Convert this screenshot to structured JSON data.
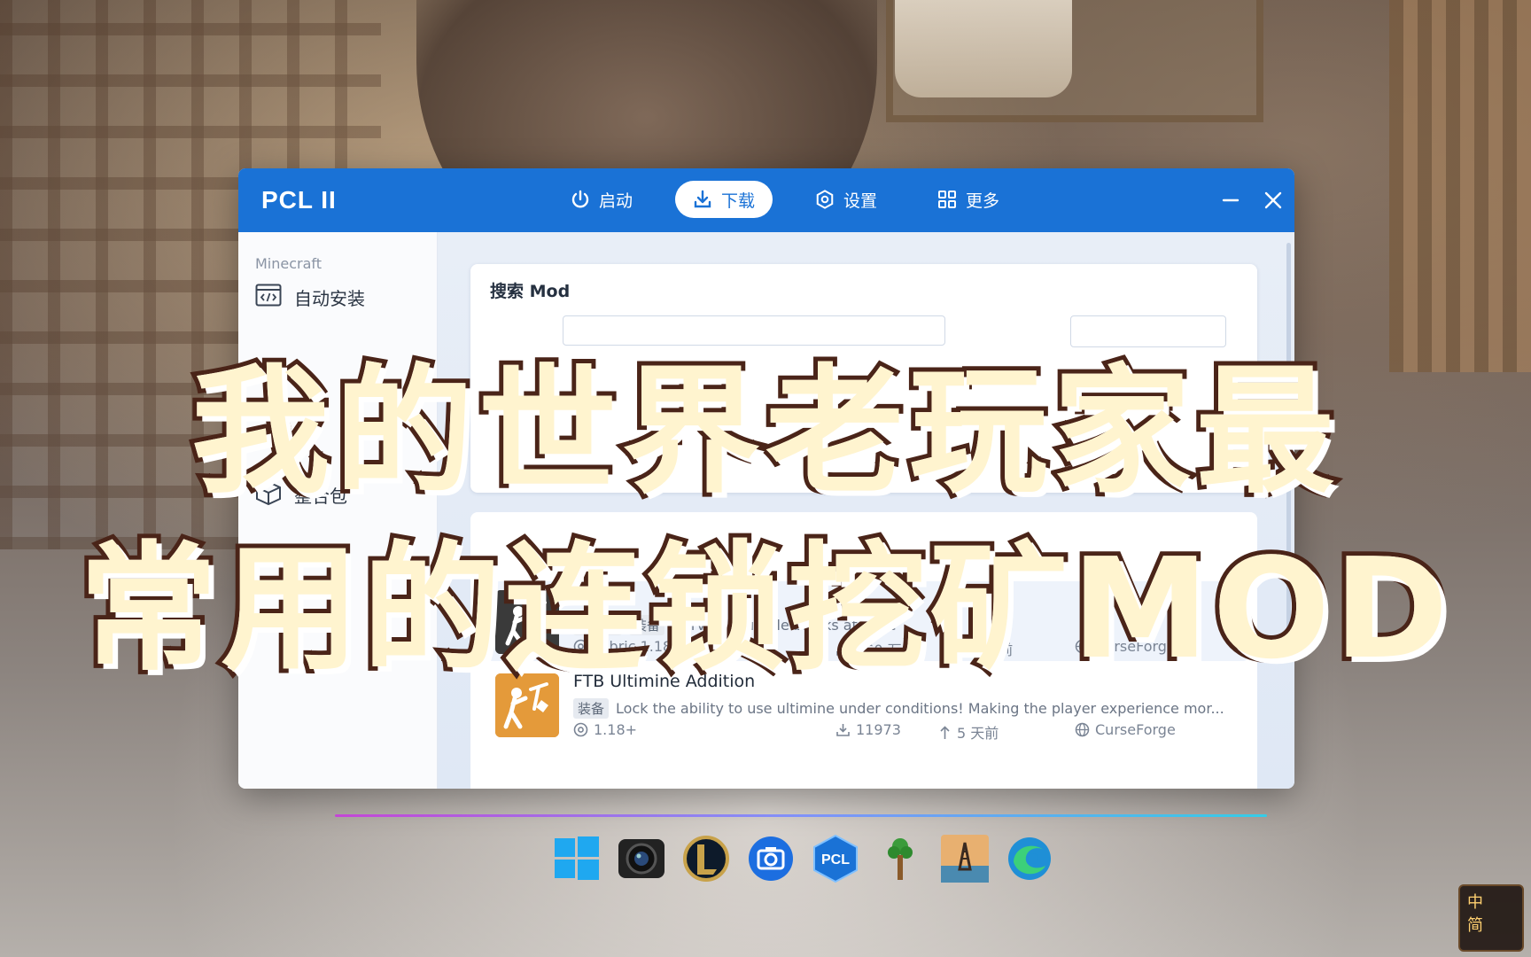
{
  "window": {
    "title": "PCL II",
    "nav_tabs": [
      {
        "label": "启动",
        "icon": "power-icon",
        "active": false
      },
      {
        "label": "下载",
        "icon": "download-icon",
        "active": true
      },
      {
        "label": "设置",
        "icon": "settings-icon",
        "active": false
      },
      {
        "label": "更多",
        "icon": "grid-icon",
        "active": false
      }
    ],
    "controls": {
      "minimize": "minimize-icon",
      "close": "close-icon"
    }
  },
  "sidebar": {
    "section": "Minecraft",
    "items": [
      {
        "label": "自动安装",
        "icon": "code-window-icon"
      },
      {
        "label": "整合包",
        "icon": "box-icon"
      }
    ]
  },
  "search": {
    "title": "搜索 Mod",
    "placeholder": ""
  },
  "results": [
    {
      "name": "",
      "tags": [
        "服务器",
        "装备"
      ],
      "description": "Harvest multiple blocks at once",
      "version": "Fabric 1.18+, 1.16",
      "downloads": "160 万",
      "updated": "2 个月前",
      "source": "CurseForge",
      "icon_color": "#3a3a3a",
      "hover": true
    },
    {
      "name": "FTB Ultimine Addition",
      "tags": [
        "装备"
      ],
      "description": "Lock the ability to use ultimine under conditions! Making the player experience mor...",
      "version": "1.18+",
      "downloads": "11973",
      "updated": "5 天前",
      "source": "CurseForge",
      "icon_color": "#e49a3a",
      "hover": false
    }
  ],
  "headline": {
    "line1": "我的世界老玩家最",
    "line2": "常用的连锁挖矿MOD"
  },
  "dock": {
    "apps": [
      "windows-start-icon",
      "camera-app-icon",
      "league-of-legends-icon",
      "screenshot-app-icon",
      "pcl-launcher-icon",
      "terraria-tree-icon",
      "oil-rig-game-icon",
      "edge-browser-icon"
    ],
    "pcl_label": "PCL"
  },
  "tray": {
    "ime_line1": "中",
    "ime_line2": "简"
  },
  "colors": {
    "titlebar": "#1a72d6",
    "headline_fill": "#fff4cf",
    "headline_stroke": "#4a2418"
  }
}
